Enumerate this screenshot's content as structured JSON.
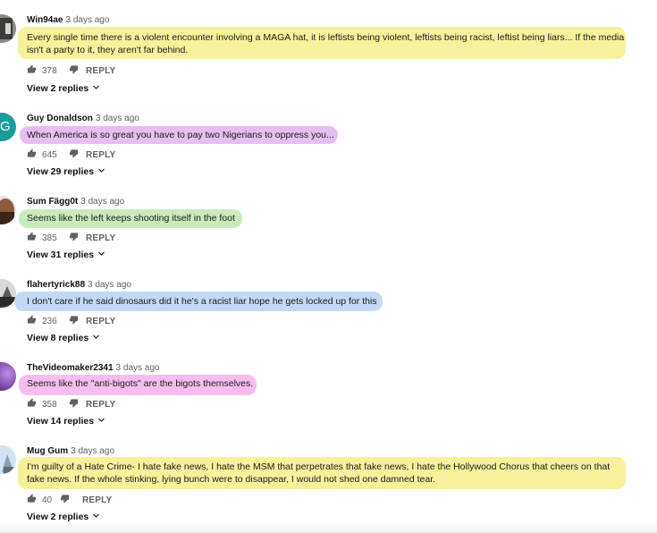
{
  "comments": [
    {
      "author": "Win94ae",
      "time": "3 days ago",
      "text": "Every single time there is a violent encounter involving a MAGA hat, it is leftists being violent, leftists being racist, leftist being liars... If the media isn't a party to it, they aren't far behind.",
      "likes": "378",
      "reply_label": "REPLY",
      "view_replies": "View 2 replies",
      "highlight": "#f5f08a"
    },
    {
      "author": "Guy Donaldson",
      "time": "3 days ago",
      "text": "When America is so great you have to pay two Nigerians to oppress you...",
      "likes": "645",
      "reply_label": "REPLY",
      "view_replies": "View 29 replies",
      "avatar_letter": "G",
      "highlight": "#e3b3ee"
    },
    {
      "author": "Sum Fägg0t",
      "time": "3 days ago",
      "text": "Seems like the left keeps shooting itself in the foot",
      "likes": "385",
      "reply_label": "REPLY",
      "view_replies": "View 31 replies",
      "highlight": "#bfe8b0"
    },
    {
      "author": "flahertyrick88",
      "time": "3 days ago",
      "text": "I don't care if he said dinosaurs did it he's a racist liar hope he gets locked up for this",
      "likes": "236",
      "reply_label": "REPLY",
      "view_replies": "View 8 replies",
      "highlight": "#b7d3f5"
    },
    {
      "author": "TheVideomaker2341",
      "time": "3 days ago",
      "text": "Seems like the \"anti-bigots\" are the bigots themselves.",
      "likes": "358",
      "reply_label": "REPLY",
      "view_replies": "View 14 replies",
      "highlight": "#f5b3ec"
    },
    {
      "author": "Mug Gum",
      "time": "3 days ago",
      "text": "I'm guilty of a Hate Crime- I hate fake news, I hate the MSM that perpetrates that fake news, I hate the Hollywood Chorus that cheers on that fake news. If the whole stinking, lying bunch were to disappear, I would not shed one damned tear.",
      "likes": "40",
      "reply_label": "REPLY",
      "view_replies": "View 2 replies",
      "highlight": "#f5f08a"
    }
  ],
  "icons": {
    "like": "thumbs-up-icon",
    "dislike": "thumbs-down-icon",
    "expand": "chevron-down-icon"
  }
}
